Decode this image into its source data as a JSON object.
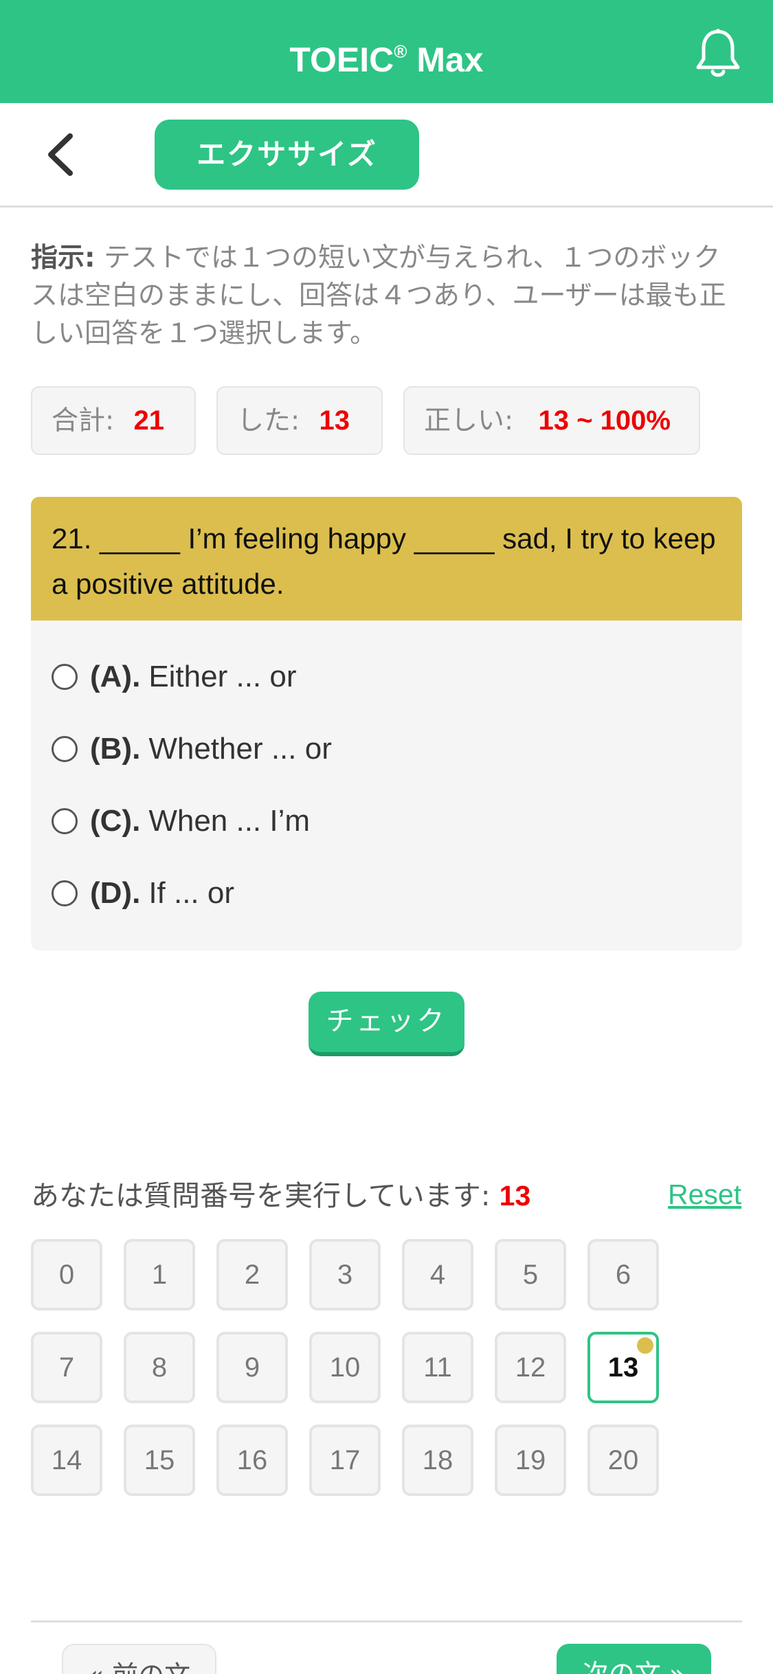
{
  "header": {
    "title": "TOEIC",
    "title_mark": "®",
    "title_suffix": " Max",
    "bell_icon": "bell-icon"
  },
  "subbar": {
    "back_icon": "chevron-left-icon",
    "tab_label": "エクササイズ"
  },
  "instructions": {
    "label": "指示:",
    "text": " テストでは１つの短い文が与えられ、１つのボックスは空白のままにし、回答は４つあり、ユーザーは最も正しい回答を１つ選択します。"
  },
  "stats": {
    "total_label": "合計:",
    "total_value": "21",
    "done_label": "した:",
    "done_value": "13",
    "correct_label": "正しい:",
    "correct_value": "13 ~ 100%"
  },
  "question": {
    "text": "21. _____ I’m feeling happy _____ sad, I try to keep a positive attitude.",
    "options": [
      {
        "letter": "(A).",
        "text": "Either ... or"
      },
      {
        "letter": "(B).",
        "text": "Whether ... or"
      },
      {
        "letter": "(C).",
        "text": "When ... I’m"
      },
      {
        "letter": "(D).",
        "text": "If ... or"
      }
    ]
  },
  "check_label": "チェック",
  "progress": {
    "running_label": "あなたは質問番号を実行しています:",
    "current": "13",
    "reset_label": "Reset",
    "numbers": [
      "0",
      "1",
      "2",
      "3",
      "4",
      "5",
      "6",
      "7",
      "8",
      "9",
      "10",
      "11",
      "12",
      "13",
      "14",
      "15",
      "16",
      "17",
      "18",
      "19",
      "20"
    ]
  },
  "footer": {
    "prev_label": "« 前の文",
    "next_label": "次の文 »"
  },
  "colors": {
    "accent": "#2ec486",
    "question_header": "#dbbe4e",
    "highlight_number": "#ee0000"
  }
}
